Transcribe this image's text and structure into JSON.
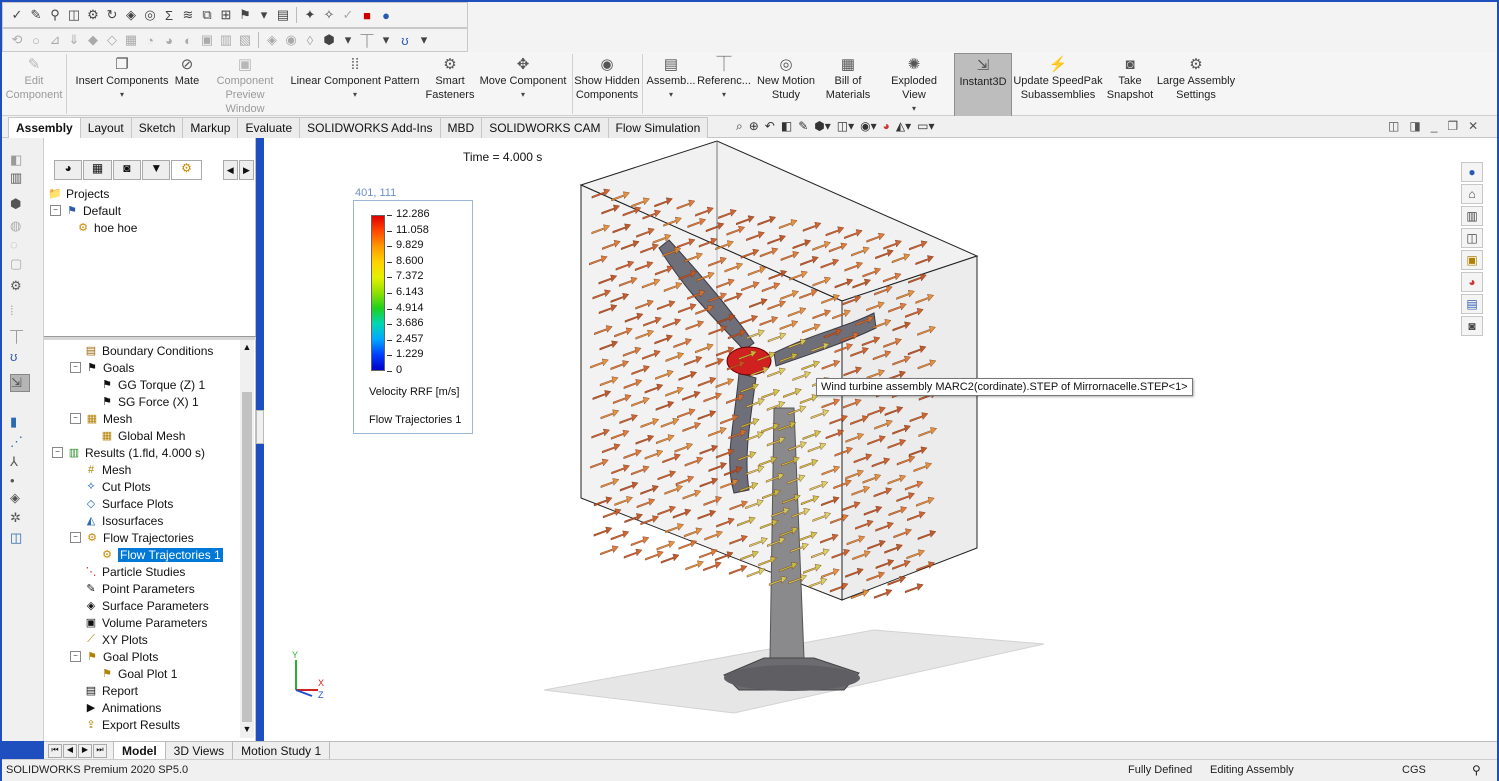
{
  "toolbar1_icons": [
    "spell-check-icon",
    "paint-icon",
    "pin-icon",
    "box-icon",
    "gear-icon",
    "rotate-icon",
    "view-icon",
    "sigma-icon",
    "layers-icon",
    "mate-icon",
    "grid-icon",
    "flag-icon",
    "chart-icon",
    "stop-icon",
    "globe-icon"
  ],
  "ribbon": {
    "edit_component": "Edit Component",
    "insert_components": "Insert Components",
    "mate": "Mate",
    "component_preview": "Component Preview Window",
    "linear_pattern": "Linear Component Pattern",
    "smart_fasteners": "Smart Fasteners",
    "move_component": "Move Component",
    "show_hidden": "Show Hidden Components",
    "assembly": "Assemb...",
    "reference": "Referenc...",
    "new_motion_study": "New Motion Study",
    "bill_of_materials": "Bill of Materials",
    "exploded_view": "Exploded View",
    "instant3d": "Instant3D",
    "update_speedpak": "Update SpeedPak Subassemblies",
    "take_snapshot": "Take Snapshot",
    "large_assembly": "Large Assembly Settings"
  },
  "tabs": [
    "Assembly",
    "Layout",
    "Sketch",
    "Markup",
    "Evaluate",
    "SOLIDWORKS Add-Ins",
    "MBD",
    "SOLIDWORKS CAM",
    "Flow Simulation"
  ],
  "top_tree": {
    "projects": "Projects",
    "default": "Default",
    "hoe": "hoe hoe"
  },
  "tree": {
    "boundary_conditions": "Boundary Conditions",
    "goals": "Goals",
    "gg_torque": "GG Torque (Z) 1",
    "sg_force": "SG Force (X) 1",
    "mesh": "Mesh",
    "global_mesh": "Global Mesh",
    "results": "Results (1.fld, 4.000 s)",
    "results_mesh": "Mesh",
    "cut_plots": "Cut Plots",
    "surface_plots": "Surface Plots",
    "isosurfaces": "Isosurfaces",
    "flow_trajectories": "Flow Trajectories",
    "flow_trajectories_1": "Flow Trajectories 1",
    "particle_studies": "Particle Studies",
    "point_parameters": "Point Parameters",
    "surface_parameters": "Surface Parameters",
    "volume_parameters": "Volume Parameters",
    "xy_plots": "XY Plots",
    "goal_plots": "Goal Plots",
    "goal_plot_1": "Goal Plot 1",
    "report": "Report",
    "animations": "Animations",
    "export_results": "Export Results"
  },
  "viewport": {
    "time": "Time = 4.000 s",
    "coords": "401, 111",
    "tooltip": "Wind turbine assembly MARC2(cordinate).STEP of Mirrornacelle.STEP<1>",
    "triad_y": "Y",
    "triad_x": "X",
    "triad_z": "Z"
  },
  "legend": {
    "values": [
      "12.286",
      "11.058",
      "9.829",
      "8.600",
      "7.372",
      "6.143",
      "4.914",
      "3.686",
      "2.457",
      "1.229",
      "0"
    ],
    "colors": [
      "#e00000",
      "#ff4a00",
      "#ff9a00",
      "#ffd200",
      "#e5f000",
      "#8fe000",
      "#1fd01f",
      "#00d6b4",
      "#00a8ff",
      "#0040ff",
      "#0000c8"
    ],
    "title": "Velocity RRF [m/s]",
    "name": "Flow Trajectories 1"
  },
  "bottom_tabs": [
    "Model",
    "3D Views",
    "Motion Study 1"
  ],
  "status": {
    "product": "SOLIDWORKS Premium 2020 SP5.0",
    "defined": "Fully Defined",
    "editing": "Editing Assembly",
    "units": "CGS"
  }
}
